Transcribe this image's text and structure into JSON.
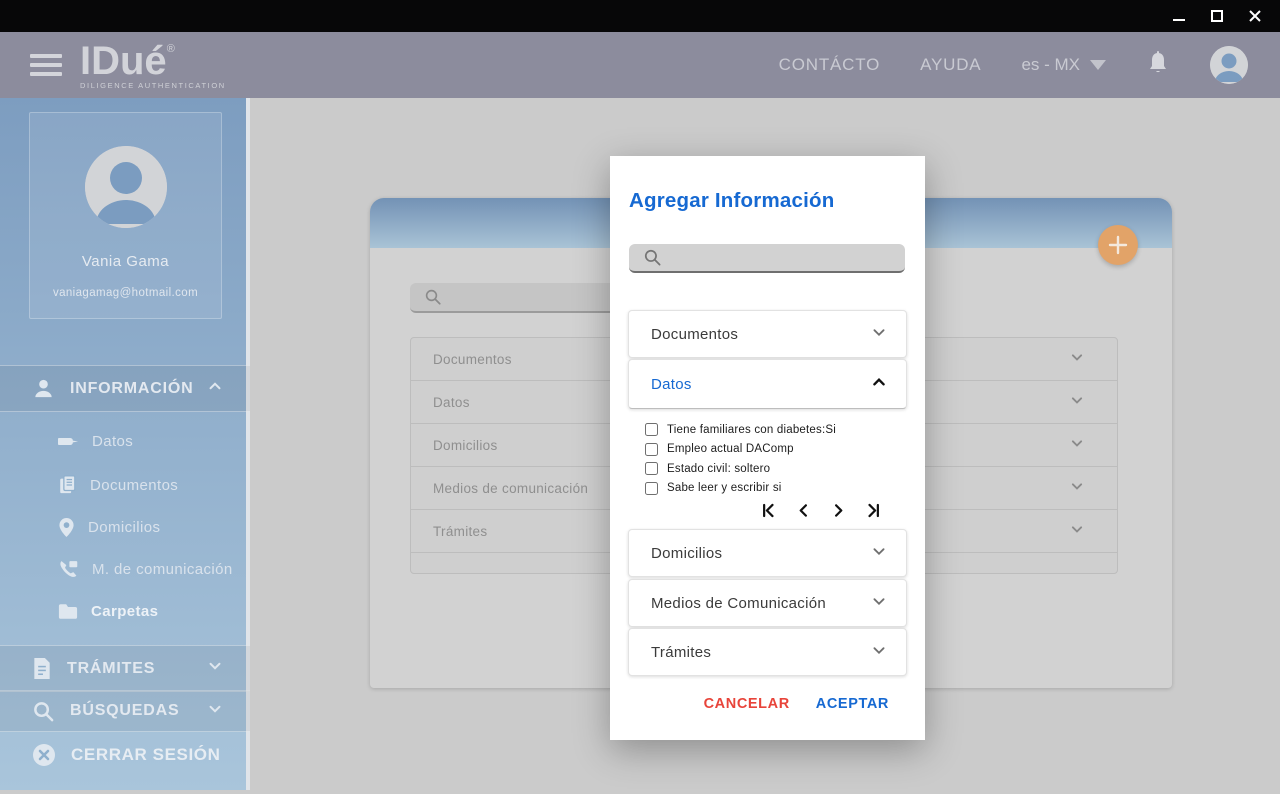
{
  "colors": {
    "accent_blue": "#1669d2",
    "cancel_red": "#e8443a",
    "fab_orange": "#e2a368",
    "header_bg": "#8c8c9d",
    "sidebar_blue": "#8badca"
  },
  "header": {
    "brand": "IDué",
    "brand_mark": "®",
    "brand_subtitle": "DILIGENCE AUTHENTICATION",
    "nav_contacto": "CONTÁCTO",
    "nav_ayuda": "AYUDA",
    "language": "es - MX"
  },
  "sidebar": {
    "profile": {
      "name": "Vania Gama",
      "email": "vaniagamag@hotmail.com"
    },
    "section_informacion": "INFORMACIÓN",
    "items": [
      {
        "label": "Datos"
      },
      {
        "label": "Documentos"
      },
      {
        "label": "Domicilios"
      },
      {
        "label": "M. de comunicación"
      },
      {
        "label": "Carpetas"
      }
    ],
    "section_tramites": "TRÁMITES",
    "section_busquedas": "BÚSQUEDAS",
    "logout": "CERRAR SESIÓN"
  },
  "content": {
    "search_value": "",
    "rows": [
      {
        "label": "Documentos"
      },
      {
        "label": "Datos"
      },
      {
        "label": "Domicilios"
      },
      {
        "label": "Medios de comunicación"
      },
      {
        "label": "Trámites"
      }
    ]
  },
  "modal": {
    "title": "Agregar Información",
    "search_value": "",
    "panel_documentos": "Documentos",
    "panel_datos": "Datos",
    "datos_options": [
      {
        "label": "Tiene familiares con diabetes:Si",
        "checked": false
      },
      {
        "label": "Empleo actual DAComp",
        "checked": false
      },
      {
        "label": "Estado civil: soltero",
        "checked": false
      },
      {
        "label": "Sabe leer y escribir si",
        "checked": false
      }
    ],
    "panel_domicilios": "Domicilios",
    "panel_medios": "Medios de Comunicación",
    "panel_tramites": "Trámites",
    "cancel": "CANCELAR",
    "accept": "ACEPTAR"
  }
}
